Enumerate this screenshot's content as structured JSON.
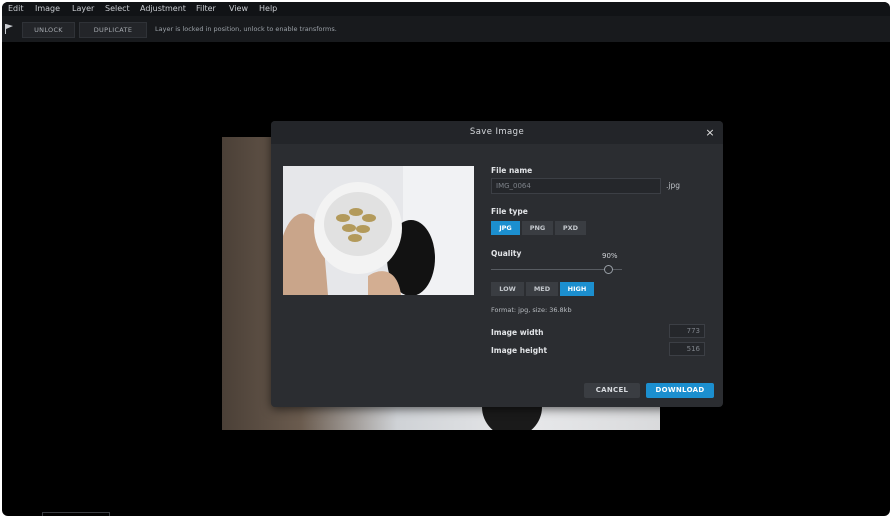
{
  "menu": {
    "items": [
      "Edit",
      "Image",
      "Layer",
      "Select",
      "Adjustment",
      "Filter",
      "View",
      "Help"
    ]
  },
  "toolbar": {
    "flag_icon": "flag-icon",
    "unlock_label": "UNLOCK",
    "duplicate_label": "DUPLICATE",
    "lock_message": "Layer is locked in position, unlock to enable transforms."
  },
  "dialog": {
    "title": "Save Image",
    "close_icon": "×",
    "file_name_label": "File name",
    "file_name_value": "IMG_0064",
    "file_extension": ".jpg",
    "file_type_label": "File type",
    "file_types": [
      {
        "label": "JPG",
        "selected": true
      },
      {
        "label": "PNG",
        "selected": false
      },
      {
        "label": "PXD",
        "selected": false
      }
    ],
    "quality_label": "Quality",
    "quality_value": "90%",
    "quality_fraction": 0.9,
    "quality_presets": [
      {
        "label": "LOW",
        "selected": false
      },
      {
        "label": "MED",
        "selected": false
      },
      {
        "label": "HIGH",
        "selected": true
      }
    ],
    "format_info": "Format: jpg, size: 36.8kb",
    "width_label": "Image width",
    "width_value": "773",
    "height_label": "Image height",
    "height_value": "516",
    "cancel_label": "CANCEL",
    "download_label": "DOWNLOAD"
  },
  "colors": {
    "accent": "#1c8fcf",
    "dialog_bg": "#2b2d31",
    "workspace_bg": "#000000"
  }
}
